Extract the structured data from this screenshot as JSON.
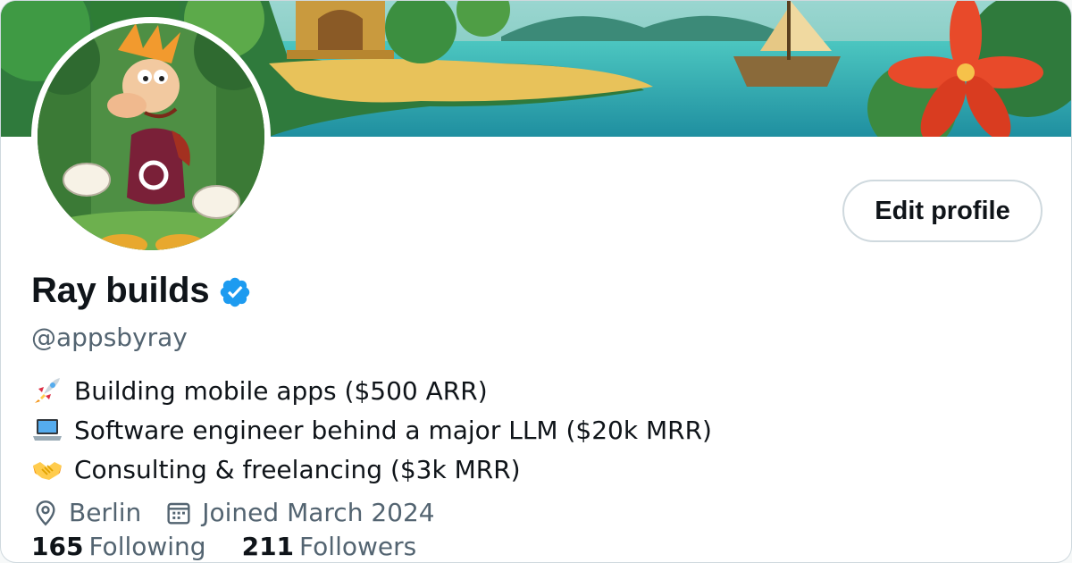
{
  "profile": {
    "display_name": "Ray builds",
    "handle": "@appsbyray",
    "verified": true,
    "edit_button_label": "Edit profile"
  },
  "bio": [
    {
      "icon": "rocket-icon",
      "text": "Building mobile apps ($500 ARR)"
    },
    {
      "icon": "laptop-icon",
      "text": "Software engineer behind a major LLM ($20k MRR)"
    },
    {
      "icon": "handshake-icon",
      "text": "Consulting & freelancing ($3k MRR)"
    }
  ],
  "meta": {
    "location": "Berlin",
    "joined": "Joined March 2024"
  },
  "stats": {
    "following_count": "165",
    "following_label": "Following",
    "followers_count": "211",
    "followers_label": "Followers"
  },
  "colors": {
    "verified_blue": "#1d9bf0",
    "secondary_text": "#536471",
    "primary_text": "#0f1419",
    "border": "#cfd9de"
  }
}
